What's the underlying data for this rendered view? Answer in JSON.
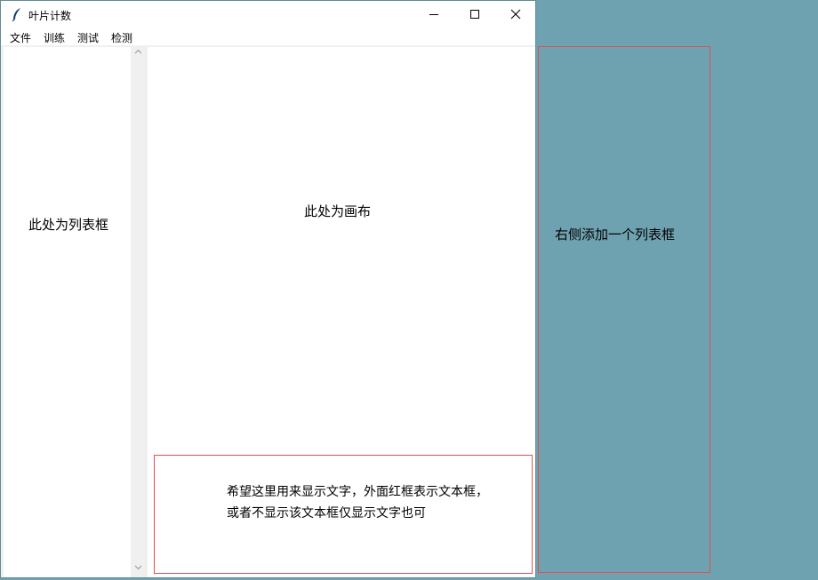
{
  "window": {
    "title": "叶片计数",
    "menu": [
      "文件",
      "训练",
      "测试",
      "检测"
    ]
  },
  "left_listbox": {
    "label": "此处为列表框"
  },
  "canvas": {
    "label": "此处为画布"
  },
  "textbox": {
    "line1": "希望这里用来显示文字，外面红框表示文本框，",
    "line2": "或者不显示该文本框仅显示文字也可"
  },
  "right_panel": {
    "label": "右侧添加一个列表框"
  },
  "colors": {
    "desktop": "#6fa2b1",
    "annotation_border": "#e05050"
  },
  "icons": [
    "feather-icon",
    "minimize-icon",
    "maximize-icon",
    "close-icon",
    "chevron-up-icon",
    "chevron-down-icon"
  ]
}
